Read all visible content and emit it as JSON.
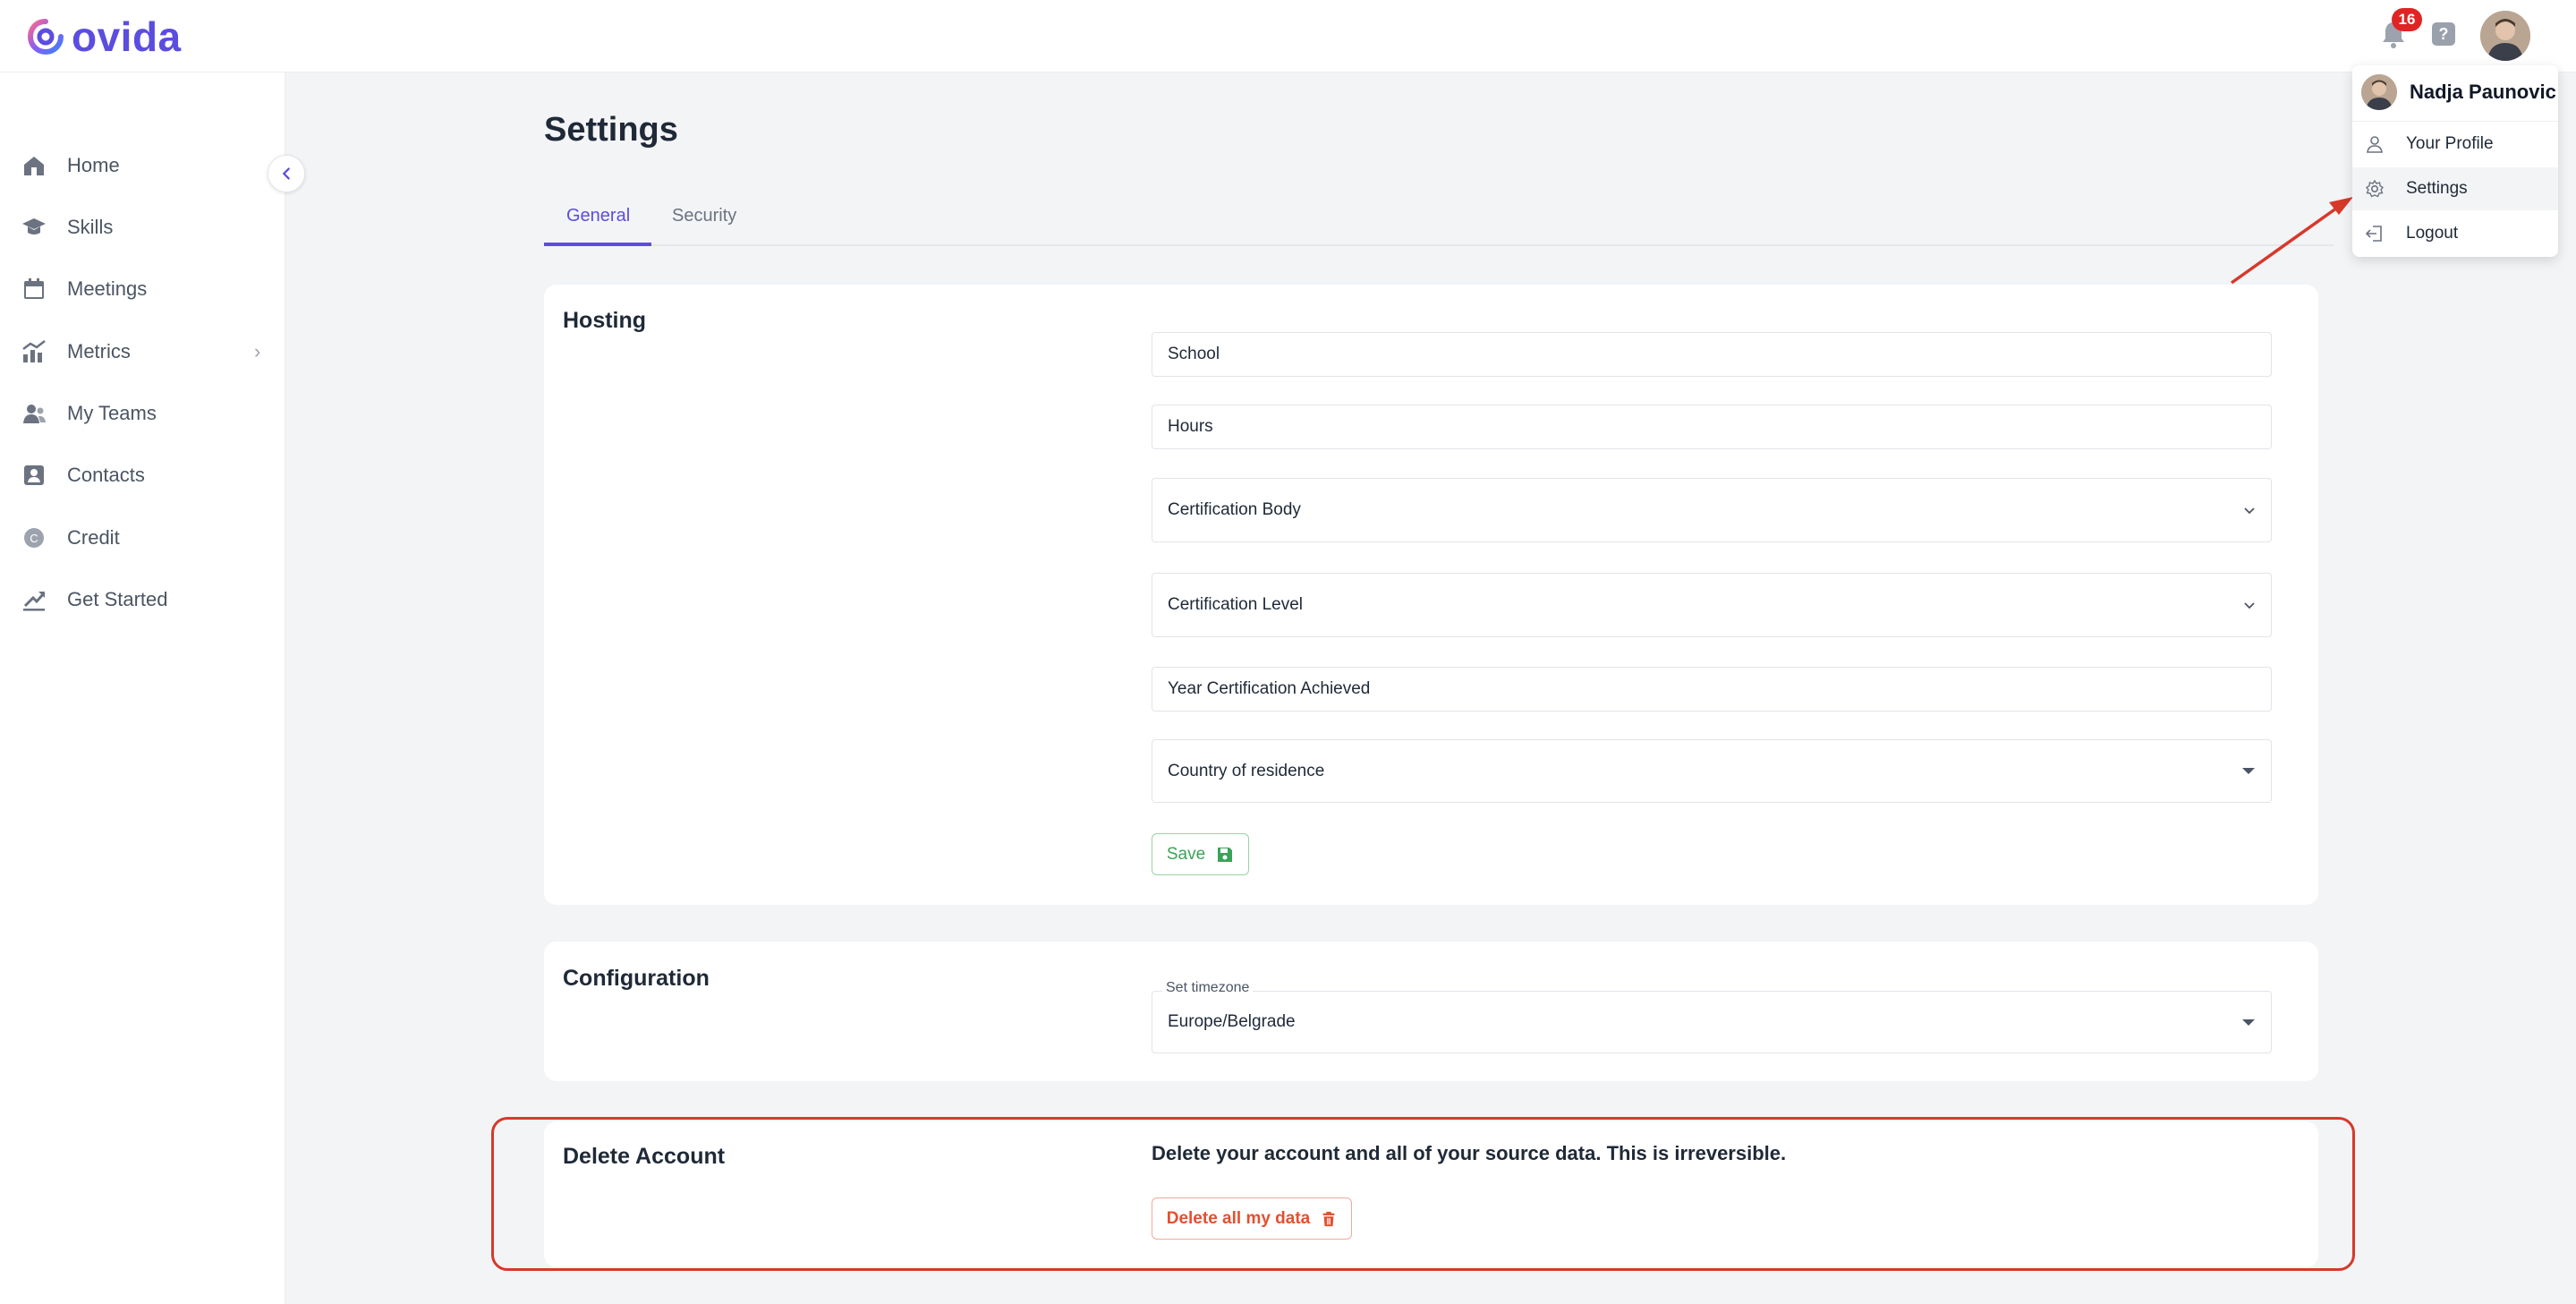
{
  "brand": {
    "name": "ovida",
    "color": "#5b4de0"
  },
  "header": {
    "notification_count": "16",
    "help_icon": "?",
    "icons": [
      "bell-icon",
      "help-icon",
      "user-avatar"
    ]
  },
  "sidebar": {
    "items": [
      {
        "label": "Home",
        "icon": "home-icon"
      },
      {
        "label": "Skills",
        "icon": "graduation-cap-icon"
      },
      {
        "label": "Meetings",
        "icon": "calendar-icon"
      },
      {
        "label": "Metrics",
        "icon": "chart-icon",
        "chevron": "›"
      },
      {
        "label": "My Teams",
        "icon": "users-icon"
      },
      {
        "label": "Contacts",
        "icon": "contact-card-icon"
      },
      {
        "label": "Credit",
        "icon": "credit-coin-icon"
      },
      {
        "label": "Get Started",
        "icon": "rocket-icon"
      }
    ],
    "collapse_icon": "‹"
  },
  "page": {
    "title": "Settings",
    "tabs": [
      {
        "label": "General",
        "active": true
      },
      {
        "label": "Security",
        "active": false
      }
    ]
  },
  "hosting": {
    "title": "Hosting",
    "fields": {
      "school": "School",
      "hours": "Hours",
      "certification_body": "Certification Body",
      "certification_level": "Certification Level",
      "year_certification": "Year Certification Achieved",
      "country": "Country of residence"
    },
    "save_label": "Save"
  },
  "configuration": {
    "title": "Configuration",
    "timezone_label": "Set timezone",
    "timezone_value": "Europe/Belgrade"
  },
  "delete_account": {
    "title": "Delete Account",
    "description": "Delete your account and all of your source data. This is irreversible.",
    "button_label": "Delete all my data"
  },
  "user_menu": {
    "name": "Nadja Paunovic",
    "items": [
      {
        "label": "Your Profile",
        "icon": "user-icon"
      },
      {
        "label": "Settings",
        "icon": "gear-icon",
        "highlighted": true
      },
      {
        "label": "Logout",
        "icon": "logout-icon"
      }
    ]
  },
  "colors": {
    "accent": "#5b4de0",
    "save_green": "#3ba25a",
    "danger": "#e3502f",
    "annotation_red": "#d6392a",
    "badge_red": "#e02424"
  }
}
